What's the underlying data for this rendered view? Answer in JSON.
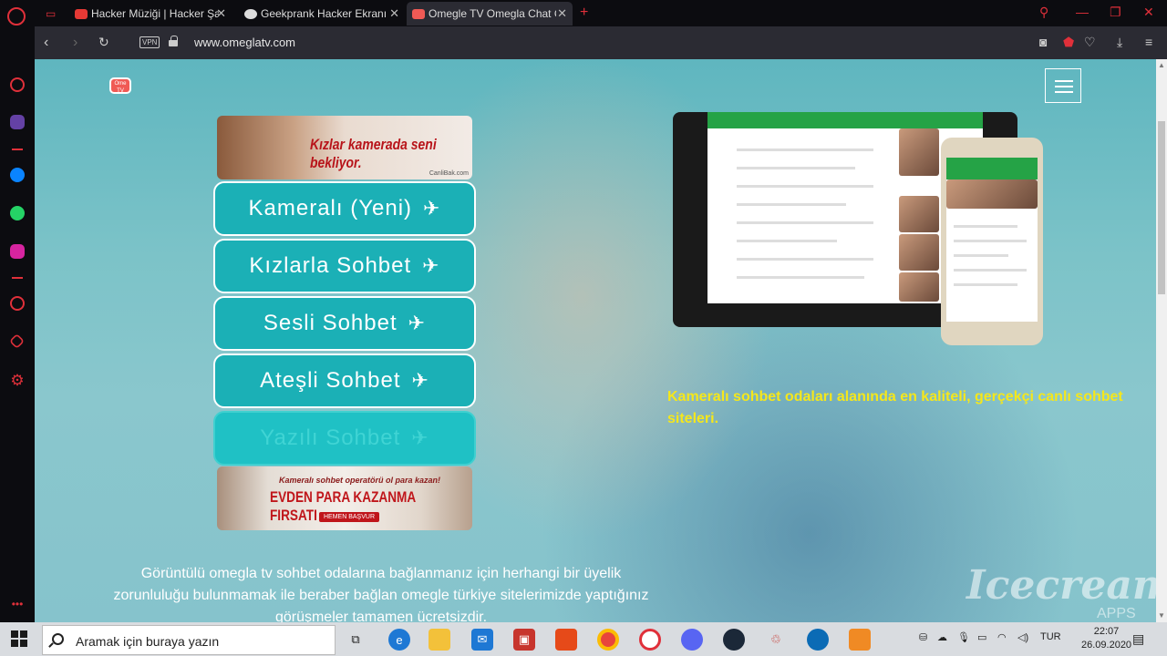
{
  "browser": {
    "tabs": [
      {
        "title": "Hacker Müziği | Hacker Şar",
        "color": "#e53935"
      },
      {
        "title": "Geekprank Hacker Ekranı -",
        "color": "#dddddd"
      },
      {
        "title": "Omegle TV Omegla Chat G",
        "color": "#f05a55"
      }
    ],
    "new_tab": "+",
    "url": "www.omeglatv.com",
    "vpn": "VPN"
  },
  "page": {
    "logo": "Ome TV",
    "top_banner": {
      "text": "Kızlar kamerada seni bekliyor.",
      "source": "CanliBak.com"
    },
    "buttons": [
      {
        "label": "Kameralı (Yeni)"
      },
      {
        "label": "Kızlarla Sohbet"
      },
      {
        "label": "Sesli Sohbet"
      },
      {
        "label": "Ateşli Sohbet"
      },
      {
        "label": "Yazılı Sohbet"
      }
    ],
    "bottom_banner": {
      "line1": "Kameralı sohbet operatörü ol para kazan!",
      "line2": "EVDEN PARA KAZANMA FIRSATI",
      "cta": "HEMEN BAŞVUR"
    },
    "highlight": "Kameralı sohbet odaları alanında en kaliteli, gerçekçi canlı sohbet siteleri.",
    "paragraph": "Görüntülü omegla tv sohbet odalarına bağlanmanız için herhangi bir üyelik zorunluluğu bulunmamak ile beraber bağlan omegle türkiye sitelerimizde yaptığınız görüşmeler tamamen ücretsizdir."
  },
  "watermark": {
    "text": "Icecream",
    "sub": "APPS"
  },
  "taskbar": {
    "search_placeholder": "Aramak için buraya yazın",
    "lang": "TUR",
    "time": "22:07",
    "date": "26.09.2020"
  }
}
